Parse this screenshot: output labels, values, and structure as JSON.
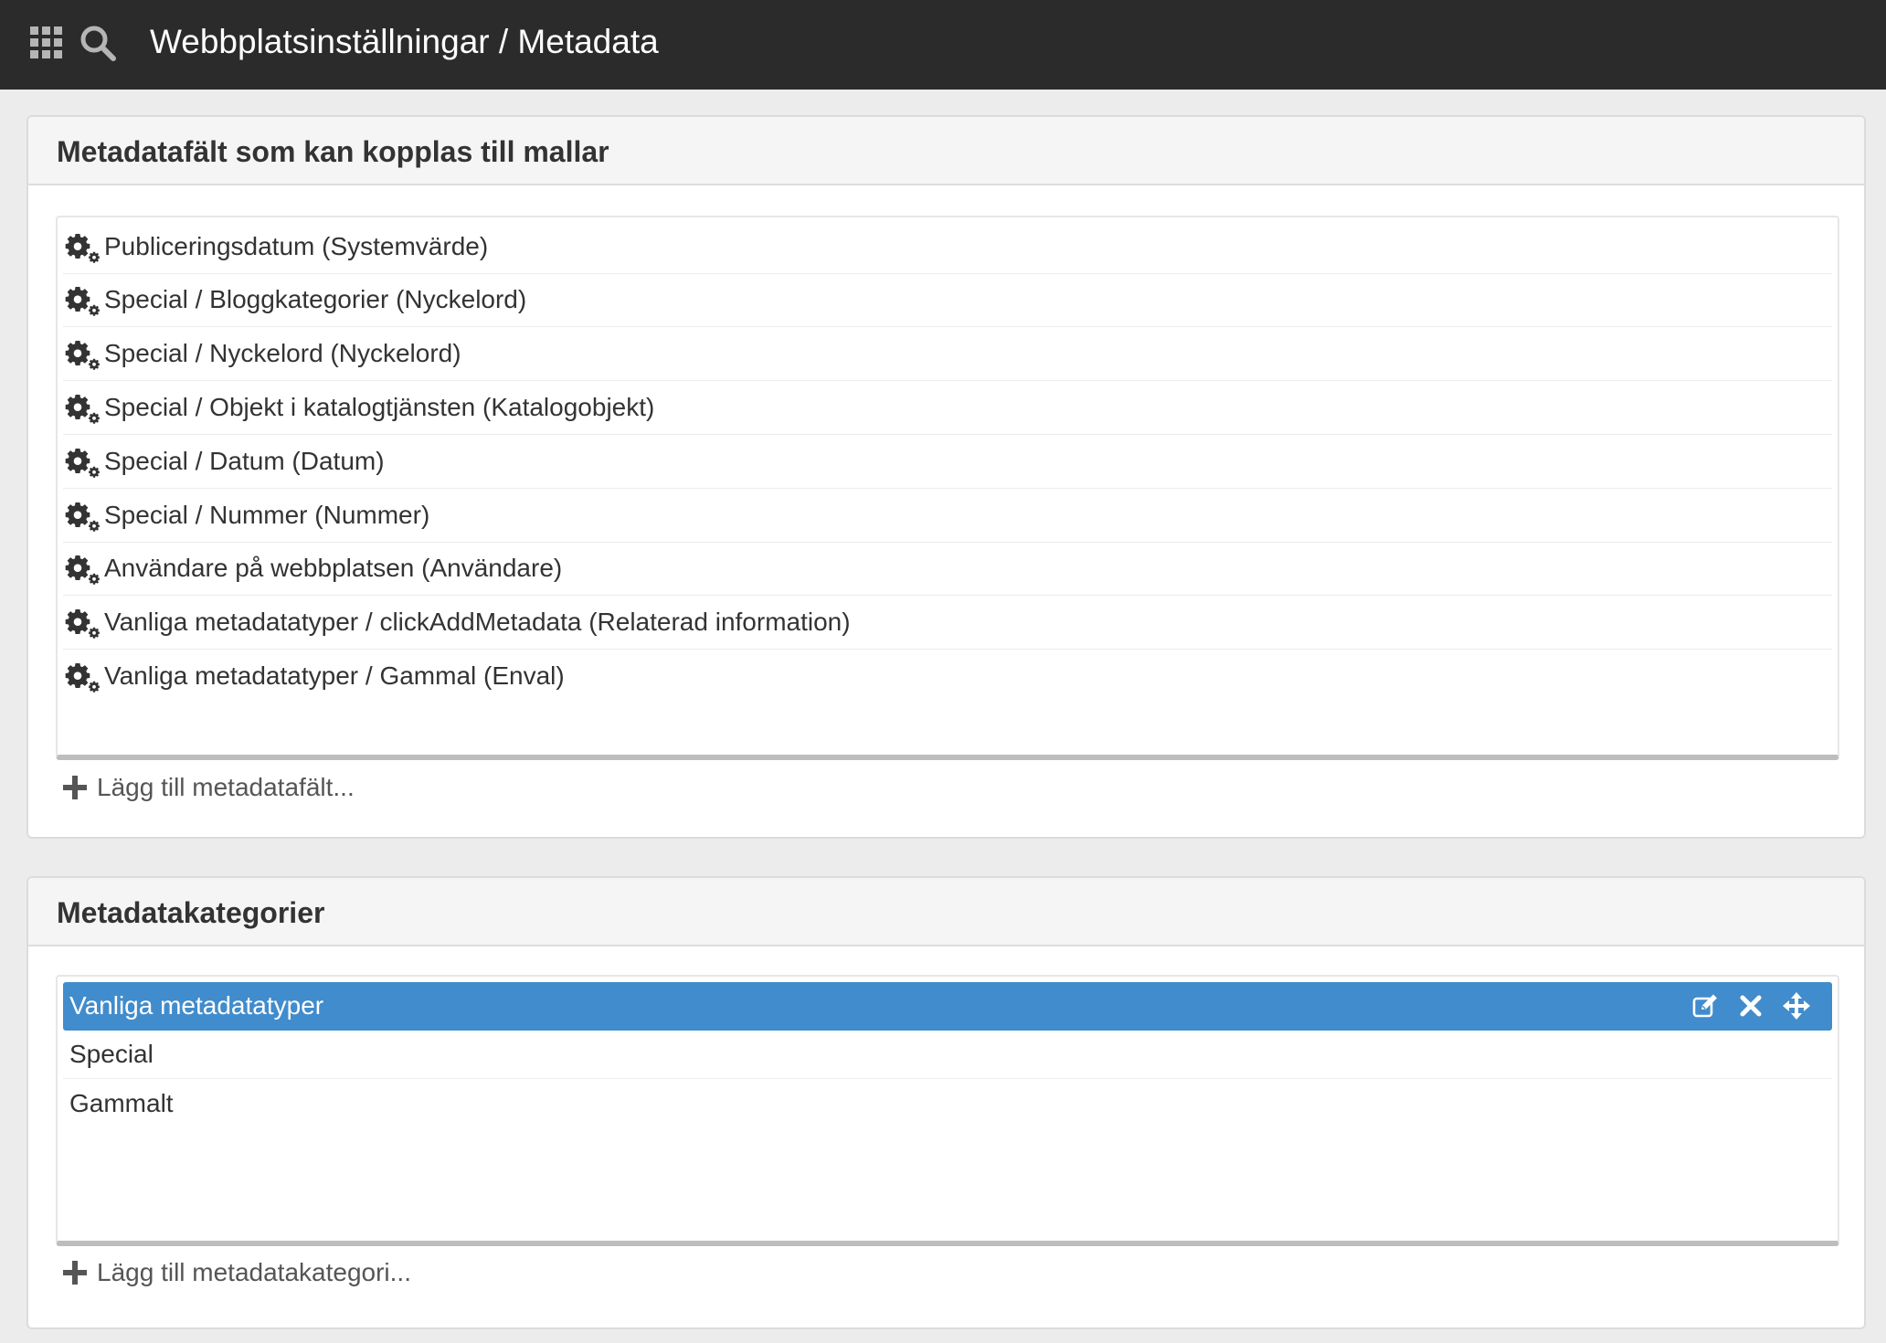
{
  "header": {
    "title": "Webbplatsinställningar / Metadata",
    "icons": [
      "apps-grid-icon",
      "search-icon"
    ]
  },
  "fields_panel": {
    "title": "Metadatafält som kan kopplas till mallar",
    "items": [
      {
        "label": "Publiceringsdatum (Systemvärde)",
        "icon": "gear-icon"
      },
      {
        "label": "Special / Bloggkategorier (Nyckelord)",
        "icon": "gear-icon"
      },
      {
        "label": "Special / Nyckelord (Nyckelord)",
        "icon": "gear-icon"
      },
      {
        "label": "Special / Objekt i katalogtjänsten (Katalogobjekt)",
        "icon": "gear-icon"
      },
      {
        "label": "Special / Datum (Datum)",
        "icon": "gear-icon"
      },
      {
        "label": "Special / Nummer (Nummer)",
        "icon": "gear-icon"
      },
      {
        "label": "Användare på webbplatsen (Användare)",
        "icon": "gear-icon"
      },
      {
        "label": "Vanliga metadatatyper / clickAddMetadata (Relaterad information)",
        "icon": "gear-icon"
      },
      {
        "label": "Vanliga metadatatyper / Gammal (Enval)",
        "icon": "gear-icon"
      }
    ],
    "add_label": "Lägg till metadatafält..."
  },
  "categories_panel": {
    "title": "Metadatakategorier",
    "items": [
      {
        "label": "Vanliga metadatatyper",
        "selected": true
      },
      {
        "label": "Special",
        "selected": false
      },
      {
        "label": "Gammalt",
        "selected": false
      }
    ],
    "selected_actions": [
      "edit-icon",
      "delete-icon",
      "move-icon"
    ],
    "add_label": "Lägg till metadatakategori..."
  },
  "colors": {
    "topbar": "#2b2b2b",
    "selected_row": "#418ccc",
    "page_background": "#ececec"
  }
}
